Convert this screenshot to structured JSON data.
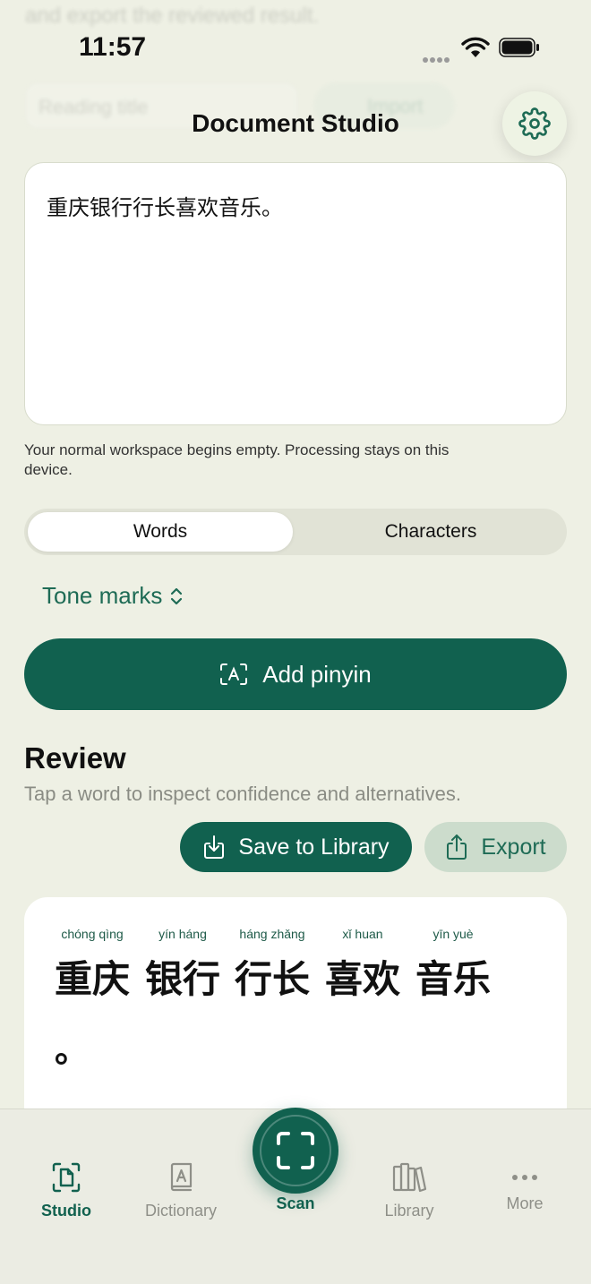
{
  "background_ghost": {
    "text": "and export the reviewed result.",
    "input_placeholder": "Reading title",
    "button_label": "Import"
  },
  "status_bar": {
    "time": "11:57"
  },
  "header": {
    "title": "Document Studio",
    "settings_icon": "gear-icon"
  },
  "input": {
    "text": "重庆银行行长喜欢音乐。"
  },
  "hint": "Your normal workspace begins empty. Processing stays on this device.",
  "segmented": {
    "words": "Words",
    "characters": "Characters",
    "selected": "Words"
  },
  "tone": {
    "label": "Tone marks"
  },
  "add_pinyin": {
    "label": "Add pinyin"
  },
  "review": {
    "title": "Review",
    "subtitle": "Tap a word to inspect confidence and alternatives.",
    "save_label": "Save to Library",
    "export_label": "Export"
  },
  "result": {
    "words": [
      {
        "pinyin": "chóng qìng",
        "hanzi": "重庆"
      },
      {
        "pinyin": "yín háng",
        "hanzi": "银行"
      },
      {
        "pinyin": "háng zhǎng",
        "hanzi": "行长"
      },
      {
        "pinyin": "xǐ huan",
        "hanzi": "喜欢"
      },
      {
        "pinyin": "yīn yuè",
        "hanzi": "音乐"
      }
    ],
    "punctuation": "。"
  },
  "tabs": {
    "studio": "Studio",
    "dictionary": "Dictionary",
    "scan": "Scan",
    "library": "Library",
    "more": "More"
  },
  "colors": {
    "accent": "#11614f",
    "background": "#eef0e4"
  }
}
